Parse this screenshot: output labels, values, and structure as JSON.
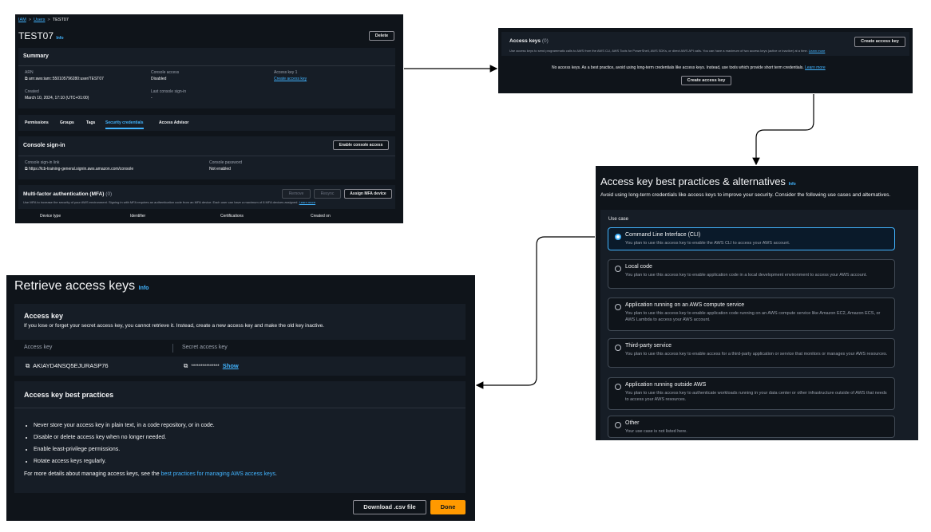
{
  "panel1": {
    "breadcrumb": [
      "IAM",
      "Users",
      "TEST07"
    ],
    "title": "TEST07",
    "info": "Info",
    "delete_label": "Delete",
    "summary_title": "Summary",
    "arn_label": "ARN",
    "arn_value": "arn:aws:iam::550105796280:user/TEST07",
    "console_access_label": "Console access",
    "console_access_value": "Disabled",
    "access_key_label": "Access key 1",
    "create_access_key_link": "Create access key",
    "created_label": "Created",
    "created_value": "March 10, 2024, 17:10 (UTC+01:00)",
    "last_signin_label": "Last console sign-in",
    "last_signin_value": "-",
    "tabs": [
      "Permissions",
      "Groups",
      "Tags",
      "Security credentials",
      "Access Advisor"
    ],
    "console_signin_title": "Console sign-in",
    "enable_console_label": "Enable console access",
    "signin_link_label": "Console sign-in link",
    "signin_link_value": "https://lcb-training-general.signin.aws.amazon.com/console",
    "console_password_label": "Console password",
    "console_password_value": "Not enabled",
    "mfa_title": "Multi-factor authentication (MFA)",
    "mfa_count": "(0)",
    "remove_label": "Remove",
    "resync_label": "Resync",
    "assign_mfa_label": "Assign MFA device",
    "mfa_desc": "Use MFA to increase the security of your AWS environment. Signing in with MFA requires an authentication code from an MFA device. Each user can have a maximum of 8 MFA devices assigned.",
    "mfa_learn_more": "Learn more",
    "mfa_columns": [
      "Device type",
      "Identifier",
      "Certifications",
      "Created on"
    ]
  },
  "panel2": {
    "title": "Access keys",
    "count": "(0)",
    "create_label": "Create access key",
    "desc": "Use access keys to send programmatic calls to AWS from the AWS CLI, AWS Tools for PowerShell, AWS SDKs, or direct AWS API calls. You can have a maximum of two access keys (active or inactive) at a time.",
    "learn_more": "Learn more",
    "empty_text": "No access keys. As a best practice, avoid using long-term credentials like access keys. Instead, use tools which provide short term credentials.",
    "empty_learn_more": "Learn more",
    "create_center_label": "Create access key"
  },
  "panel3": {
    "title": "Access key best practices & alternatives",
    "info": "Info",
    "subtitle": "Avoid using long-term credentials like access keys to improve your security. Consider the following use cases and alternatives.",
    "use_case_label": "Use case",
    "options": [
      {
        "title": "Command Line Interface (CLI)",
        "desc": "You plan to use this access key to enable the AWS CLI to access your AWS account."
      },
      {
        "title": "Local code",
        "desc": "You plan to use this access key to enable application code in a local development environment to access your AWS account."
      },
      {
        "title": "Application running on an AWS compute service",
        "desc": "You plan to use this access key to enable application code running on an AWS compute service like Amazon EC2, Amazon ECS, or AWS Lambda to access your AWS account."
      },
      {
        "title": "Third-party service",
        "desc": "You plan to use this access key to enable access for a third-party application or service that monitors or manages your AWS resources."
      },
      {
        "title": "Application running outside AWS",
        "desc": "You plan to use this access key to authenticate workloads running in your data center or other infrastructure outside of AWS that needs to access your AWS resources."
      },
      {
        "title": "Other",
        "desc": "Your use case is not listed here."
      }
    ]
  },
  "panel4": {
    "title": "Retrieve access keys",
    "info": "Info",
    "access_key_title": "Access key",
    "access_key_desc": "If you lose or forget your secret access key, you cannot retrieve it. Instead, create a new access key and make the old key inactive.",
    "col_access_key": "Access key",
    "col_secret": "Secret access key",
    "access_key_value": "AKIAYD4NSQ5EJURASP76",
    "secret_value": "***************",
    "show_label": "Show",
    "bp_title": "Access key best practices",
    "bullets": [
      "Never store your access key in plain text, in a code repository, or in code.",
      "Disable or delete access key when no longer needed.",
      "Enable least-privilege permissions.",
      "Rotate access keys regularly."
    ],
    "more_details_prefix": "For more details about managing access keys, see the",
    "more_details_link": "best practices for managing AWS access keys",
    "more_details_suffix": ".",
    "download_label": "Download .csv file",
    "done_label": "Done"
  },
  "colors": {
    "background": "#0f141a",
    "card": "#161d26",
    "link": "#42b4ff",
    "done_button": "#ff9900",
    "arrow": "#000000"
  }
}
